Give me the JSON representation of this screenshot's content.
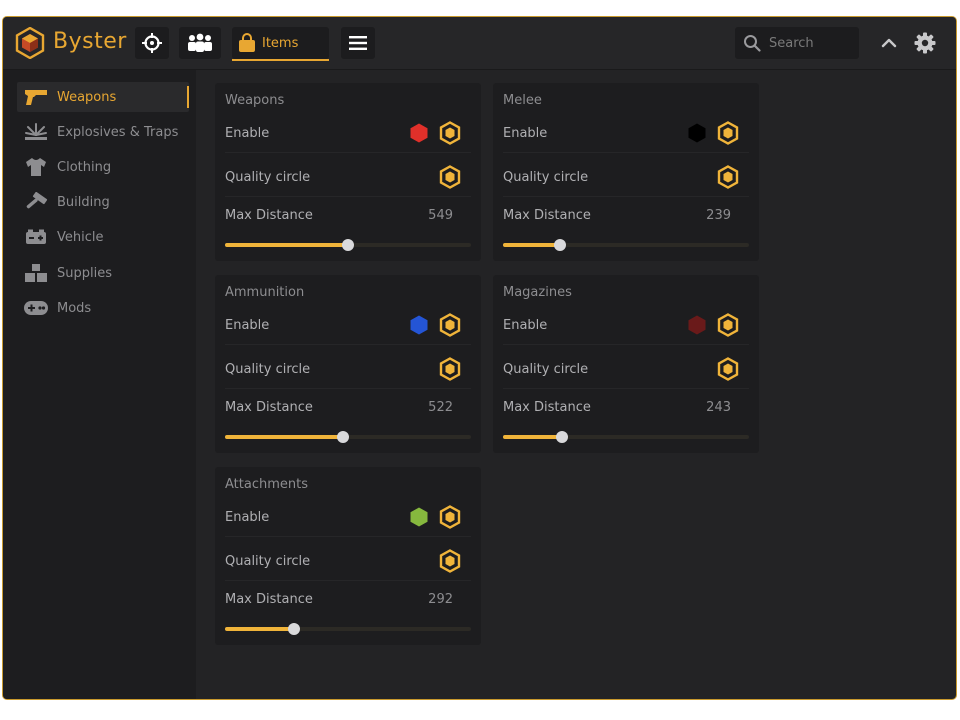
{
  "app": {
    "brand": "Byster"
  },
  "colors": {
    "accent": "#e8a732",
    "background": "#232325",
    "panel": "#1d1d1f"
  },
  "topbar": {
    "tabs": [
      {
        "icon": "crosshair-icon"
      },
      {
        "icon": "players-icon"
      },
      {
        "icon": "bag-icon",
        "label": "Items"
      },
      {
        "icon": "menu-icon"
      }
    ],
    "search": {
      "placeholder": "Search",
      "value": ""
    },
    "collapse_icon": "chevron-up-icon",
    "settings_icon": "gear-icon"
  },
  "sidebar": {
    "items": [
      {
        "label": "Weapons",
        "icon": "pistol-icon",
        "active": true
      },
      {
        "label": "Explosives & Traps",
        "icon": "explosion-icon",
        "active": false
      },
      {
        "label": "Clothing",
        "icon": "shirt-icon",
        "active": false
      },
      {
        "label": "Building",
        "icon": "hammer-icon",
        "active": false
      },
      {
        "label": "Vehicle",
        "icon": "battery-icon",
        "active": false
      },
      {
        "label": "Supplies",
        "icon": "boxes-icon",
        "active": false
      },
      {
        "label": "Mods",
        "icon": "gamepad-icon",
        "active": false
      }
    ]
  },
  "cards": [
    {
      "title": "Weapons",
      "enable_label": "Enable",
      "color": "#e0302a",
      "quality_label": "Quality circle",
      "distance_label": "Max Distance",
      "distance": "549",
      "slider_fraction": 0.5
    },
    {
      "title": "Melee",
      "enable_label": "Enable",
      "color": "#000000",
      "quality_label": "Quality circle",
      "distance_label": "Max Distance",
      "distance": "239",
      "slider_fraction": 0.23
    },
    {
      "title": "Ammunition",
      "enable_label": "Enable",
      "color": "#2455d6",
      "quality_label": "Quality circle",
      "distance_label": "Max Distance",
      "distance": "522",
      "slider_fraction": 0.48
    },
    {
      "title": "Magazines",
      "enable_label": "Enable",
      "color": "#6a1a1a",
      "quality_label": "Quality circle",
      "distance_label": "Max Distance",
      "distance": "243",
      "slider_fraction": 0.24
    },
    {
      "title": "Attachments",
      "enable_label": "Enable",
      "color": "#86b83e",
      "quality_label": "Quality circle",
      "distance_label": "Max Distance",
      "distance": "292",
      "slider_fraction": 0.28
    }
  ]
}
